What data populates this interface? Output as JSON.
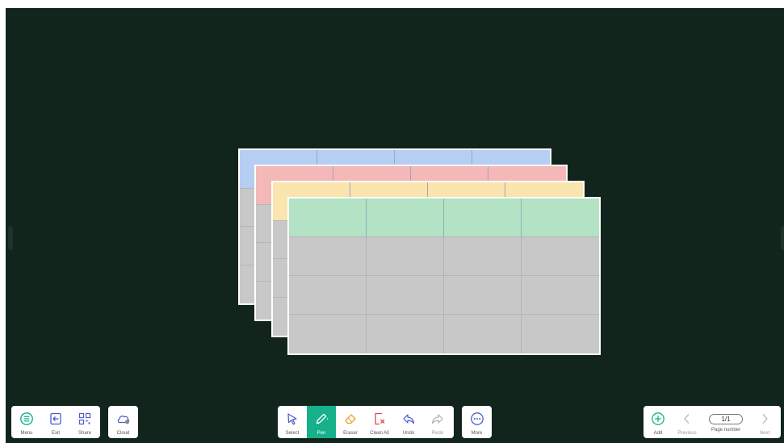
{
  "toolbar_left": {
    "menu_label": "Menu",
    "exit_label": "Exit",
    "share_label": "Share"
  },
  "cloud": {
    "label": "Cloud"
  },
  "toolbar_center": {
    "select_label": "Select",
    "pen_label": "Pen",
    "eraser_label": "Eraser",
    "clear_all_label": "Clean All",
    "undo_label": "Undo",
    "redo_label": "Redo"
  },
  "more": {
    "label": "More"
  },
  "toolbar_right": {
    "add_label": "Add",
    "previous_label": "Previous",
    "page_value": "1/1",
    "page_number_label": "Page number",
    "next_label": "Next"
  },
  "colors": {
    "board_background": "#11251d",
    "accent": "#16b08a",
    "sheet_blue": "#b6cdf4",
    "sheet_red": "#f4b8b8",
    "sheet_yellow": "#fae5ae",
    "sheet_green": "#b3e2c5",
    "sheet_body": "#c8c8c8"
  },
  "icons": {
    "menu": "hamburger-circle-icon",
    "exit": "exit-arrow-icon",
    "share": "qr-code-icon",
    "cloud": "cloud-user-icon",
    "select": "cursor-arrow-icon",
    "pen": "pen-icon",
    "eraser": "eraser-icon",
    "clear_all": "clear-page-icon",
    "undo": "undo-arrow-icon",
    "redo": "redo-arrow-icon",
    "more": "ellipsis-circle-icon",
    "add": "plus-circle-icon",
    "previous": "chevron-left-icon",
    "next": "chevron-right-icon"
  }
}
